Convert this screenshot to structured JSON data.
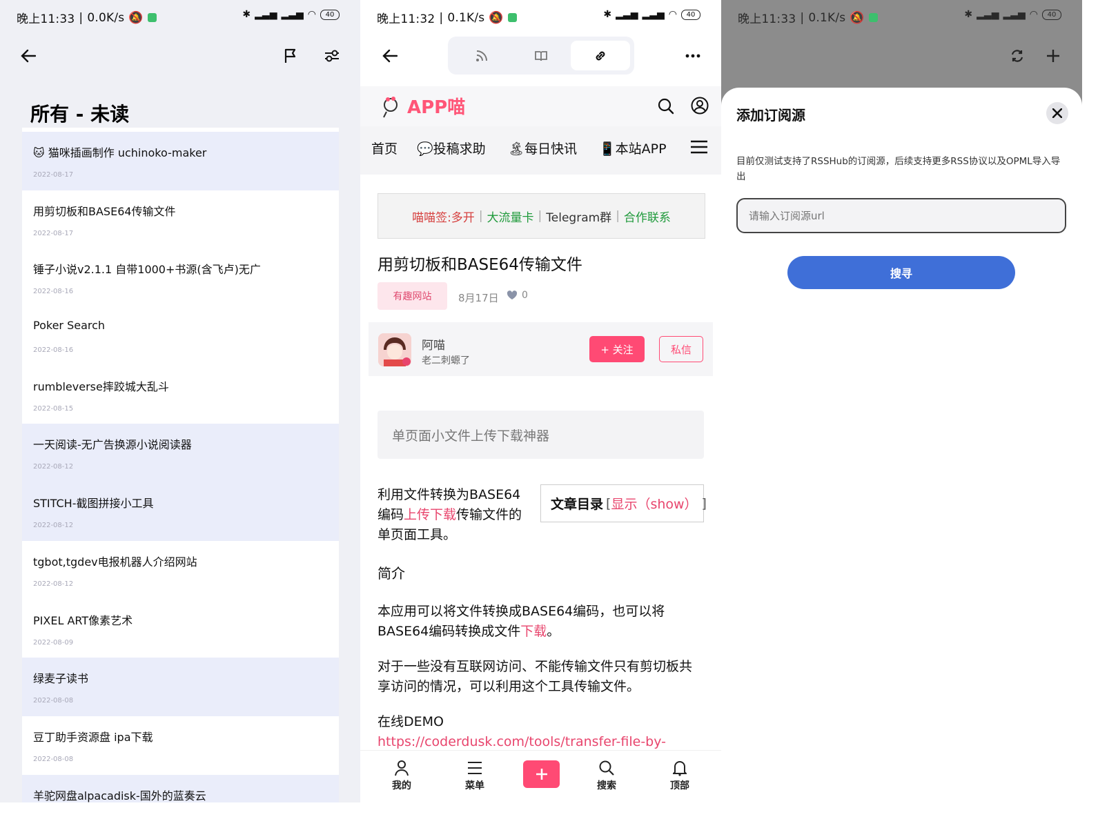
{
  "screens": {
    "list": {
      "status": {
        "time": "晚上11:33",
        "speed": "0.0K/s",
        "battery": "40"
      },
      "title": "所有 - 未读",
      "items": [
        {
          "title": "🐱 猫咪插画制作 uchinoko-maker",
          "date": "2022-08-17",
          "unread": true
        },
        {
          "title": "用剪切板和BASE64传输文件",
          "date": "2022-08-17",
          "unread": false
        },
        {
          "title": "锤子小说v2.1.1 自带1000+书源(含飞卢)无广",
          "date": "2022-08-16",
          "unread": false
        },
        {
          "title": "Poker Search",
          "date": "2022-08-16",
          "unread": false
        },
        {
          "title": "rumbleverse摔跤城大乱斗",
          "date": "2022-08-15",
          "unread": false
        },
        {
          "title": "一天阅读-无广告换源小说阅读器",
          "date": "2022-08-12",
          "unread": true
        },
        {
          "title": "STITCH-截图拼接小工具",
          "date": "2022-08-12",
          "unread": true
        },
        {
          "title": "tgbot,tgdev电报机器人介绍网站",
          "date": "2022-08-12",
          "unread": false
        },
        {
          "title": "PIXEL ART像素艺术",
          "date": "2022-08-09",
          "unread": false
        },
        {
          "title": "绿麦子读书",
          "date": "2022-08-08",
          "unread": true
        },
        {
          "title": "豆丁助手资源盘  ipa下载",
          "date": "2022-08-08",
          "unread": false
        },
        {
          "title": "羊驼网盘alpacadisk-国外的蓝奏云",
          "date": "",
          "unread": true
        }
      ]
    },
    "article": {
      "status": {
        "time": "晚上11:32",
        "speed": "0.1K/s",
        "battery": "40"
      },
      "site": {
        "logo_text": "APP喵",
        "nav": [
          "首页",
          "投稿求助",
          "每日快讯",
          "本站APP"
        ]
      },
      "ad_links": [
        "喵喵签:多开",
        "大流量卡",
        "Telegram群",
        "合作联系"
      ],
      "ad_sep": "|",
      "title": "用剪切板和BASE64传输文件",
      "tag": "有趣网站",
      "date": "8月17日",
      "likes": "0",
      "author": {
        "name": "阿喵",
        "bio": "老二刺螈了",
        "follow": "+ 关注",
        "message": "私信"
      },
      "quote": "单页面小文件上传下载神器",
      "intro_a": "利用文件转换为BASE64编码",
      "intro_link": "上传下载",
      "intro_b": "传输文件的单页面工具。",
      "toc_label": "文章目录",
      "toc_toggle": "显示（show）",
      "toc_open": "[",
      "toc_close": "]",
      "h_intro": "简介",
      "p1_a": "本应用可以将文件转换成BASE64编码，也可以将BASE64编码转换成文件",
      "p1_link": "下载",
      "p1_end": "。",
      "p2": "对于一些没有互联网访问、不能传输文件只有剪切板共享访问的情况，可以利用这个工具传输文件。",
      "demo_label": "在线DEMO",
      "demo_url": "https://coderdusk.com/tools/transfer-file-by-",
      "bottom_nav": [
        "我的",
        "菜单",
        "搜索",
        "顶部"
      ]
    },
    "add": {
      "status": {
        "time": "晚上11:33",
        "speed": "0.1K/s",
        "battery": "40"
      },
      "sheet_title": "添加订阅源",
      "desc": "目前仅测试支持了RSSHub的订阅源，后续支持更多RSS协议以及OPML导入导出",
      "input_placeholder": "请输入订阅源url",
      "button": "搜寻"
    }
  },
  "colors": {
    "accent_pink": "#ff4a74",
    "accent_blue": "#3f6fd8",
    "unread_bg": "#eaedfa"
  }
}
